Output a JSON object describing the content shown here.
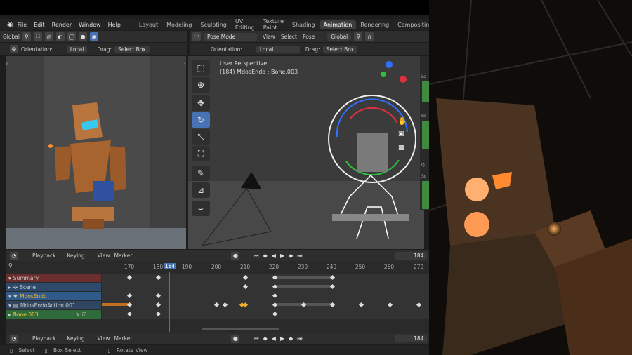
{
  "menubar": {
    "items": [
      "File",
      "Edit",
      "Render",
      "Window",
      "Help"
    ],
    "workspaces": [
      "Layout",
      "Modeling",
      "Sculpting",
      "UV Editing",
      "Texture Paint",
      "Shading",
      "Animation",
      "Rendering",
      "Compositing"
    ],
    "active_workspace": "Animation"
  },
  "left_header": {
    "transform": "Global",
    "orientation_label": "Orientation:",
    "orientation_value": "Local",
    "drag_label": "Drag:",
    "drag_value": "Select Box"
  },
  "right_header": {
    "mode": "Pose Mode",
    "menu": [
      "View",
      "Select",
      "Pose"
    ],
    "transform": "Global",
    "orientation_label": "Orientation:",
    "orientation_value": "Local",
    "drag_label": "Drag:",
    "drag_value": "Select Box"
  },
  "viewport": {
    "perspective": "User Perspective",
    "object_info": "(184) MdosEndo : Bone.003"
  },
  "side_panel": {
    "labels": [
      "Lo",
      "Ro",
      "Q",
      "Sc"
    ]
  },
  "timeline": {
    "menu": [
      "Playback",
      "Keying",
      "View",
      "Marker"
    ],
    "current_frame": "184",
    "ticks": [
      "170",
      "180",
      "184",
      "190",
      "200",
      "210",
      "220",
      "230",
      "240",
      "250",
      "260",
      "270"
    ],
    "channels": [
      "Summary",
      "Scene",
      "MdosEndo",
      "MdosEndoAction.001",
      "Bone.003"
    ]
  },
  "bottom_timeline": {
    "menu": [
      "Playback",
      "Keying",
      "View",
      "Marker"
    ],
    "current_frame": "184"
  },
  "statusbar": {
    "items": [
      "Select",
      "Box Select",
      "Rotate View"
    ]
  },
  "colors": {
    "accent": "#4772b3",
    "summary": "#6b2d2d",
    "scene": "#2d4a6b",
    "object": "#2f5a8a",
    "bone": "#2f6b3a",
    "key": "#dddddd",
    "key_selected": "#f0b030"
  }
}
